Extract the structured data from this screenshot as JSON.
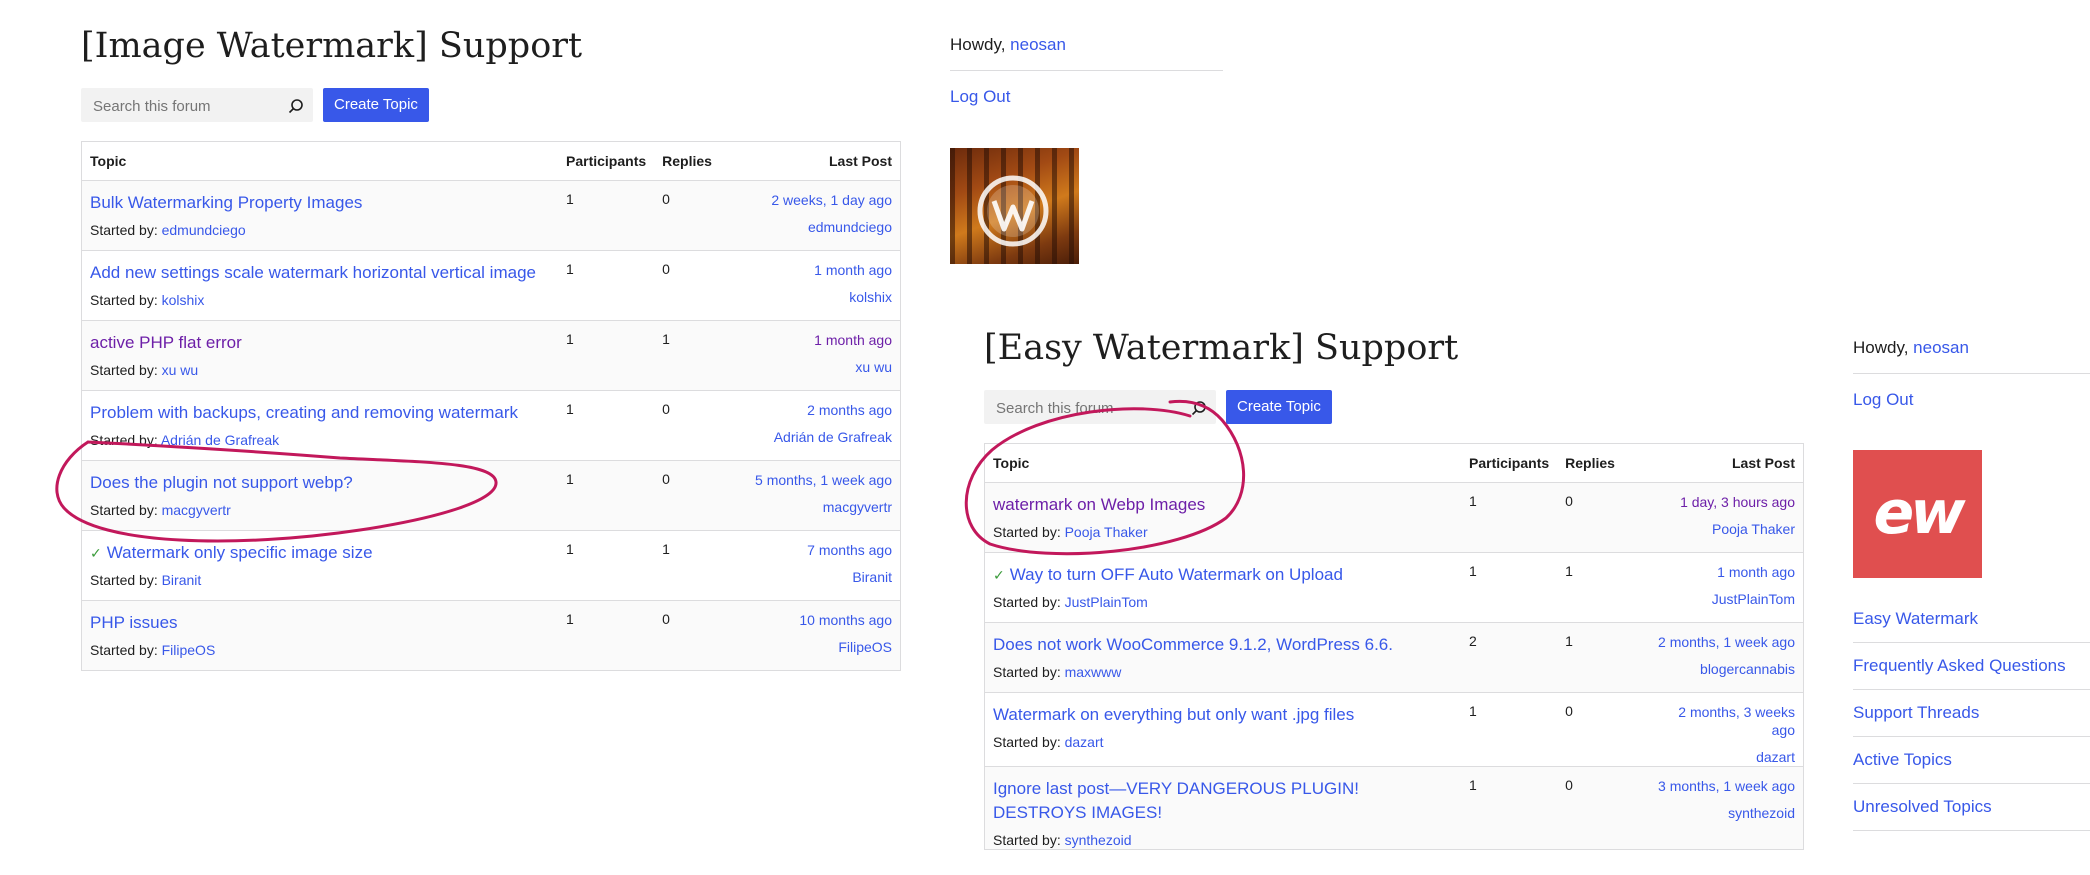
{
  "forum1": {
    "title": "[Image Watermark] Support",
    "search_placeholder": "Search this forum",
    "create_label": "Create Topic",
    "headers": {
      "topic": "Topic",
      "participants": "Participants",
      "replies": "Replies",
      "last_post": "Last Post"
    },
    "started_prefix": "Started by: ",
    "topics": [
      {
        "title": "Bulk Watermarking Property Images",
        "author": "edmundciego",
        "participants": "1",
        "replies": "0",
        "time": "2 weeks, 1 day ago",
        "last_user": "edmundciego",
        "resolved": false,
        "visited": false
      },
      {
        "title": "Add new settings scale watermark horizontal vertical image",
        "author": "kolshix",
        "participants": "1",
        "replies": "0",
        "time": "1 month ago",
        "last_user": "kolshix",
        "resolved": false,
        "visited": false
      },
      {
        "title": "active PHP flat error",
        "author": "xu wu",
        "participants": "1",
        "replies": "1",
        "time": "1 month ago",
        "last_user": "xu wu",
        "resolved": false,
        "visited": true
      },
      {
        "title": "Problem with backups, creating and removing watermark",
        "author": "Adrián de Grafreak",
        "participants": "1",
        "replies": "0",
        "time": "2 months ago",
        "last_user": "Adrián de Grafreak",
        "resolved": false,
        "visited": false
      },
      {
        "title": "Does the plugin not support webp?",
        "author": "macgyvertr",
        "participants": "1",
        "replies": "0",
        "time": "5 months, 1 week ago",
        "last_user": "macgyvertr",
        "resolved": false,
        "visited": false
      },
      {
        "title": "Watermark only specific image size",
        "author": "Biranit",
        "participants": "1",
        "replies": "1",
        "time": "7 months ago",
        "last_user": "Biranit",
        "resolved": true,
        "visited": false
      },
      {
        "title": "PHP issues",
        "author": "FilipeOS",
        "participants": "1",
        "replies": "0",
        "time": "10 months ago",
        "last_user": "FilipeOS",
        "resolved": false,
        "visited": false
      }
    ]
  },
  "sidebar1": {
    "howdy": "Howdy, ",
    "user": "neosan",
    "logout": "Log Out"
  },
  "forum2": {
    "title": "[Easy Watermark] Support",
    "search_placeholder": "Search this forum",
    "create_label": "Create Topic",
    "headers": {
      "topic": "Topic",
      "participants": "Participants",
      "replies": "Replies",
      "last_post": "Last Post"
    },
    "started_prefix": "Started by: ",
    "topics": [
      {
        "title": "watermark on Webp Images",
        "author": "Pooja Thaker",
        "participants": "1",
        "replies": "0",
        "time": "1 day, 3 hours ago",
        "last_user": "Pooja Thaker",
        "resolved": false,
        "visited": true
      },
      {
        "title": "Way to turn OFF Auto Watermark on Upload",
        "author": "JustPlainTom",
        "participants": "1",
        "replies": "1",
        "time": "1 month ago",
        "last_user": "JustPlainTom",
        "resolved": true,
        "visited": false
      },
      {
        "title": "Does not work WooCommerce 9.1.2, WordPress 6.6.",
        "author": "maxwww",
        "participants": "2",
        "replies": "1",
        "time": "2 months, 1 week ago",
        "last_user": "blogercannabis",
        "resolved": false,
        "visited": false
      },
      {
        "title": "Watermark on everything but only want .jpg files",
        "author": "dazart",
        "participants": "1",
        "replies": "0",
        "time": "2 months, 3 weeks ago",
        "last_user": "dazart",
        "resolved": false,
        "visited": false
      },
      {
        "title": "Ignore last post—VERY DANGEROUS PLUGIN! DESTROYS IMAGES!",
        "author": "synthezoid",
        "participants": "1",
        "replies": "0",
        "time": "3 months, 1 week ago",
        "last_user": "synthezoid",
        "resolved": false,
        "visited": false
      }
    ]
  },
  "sidebar2": {
    "howdy": "Howdy, ",
    "user": "neosan",
    "logout": "Log Out",
    "logo_text": "ew",
    "links": [
      "Easy Watermark",
      "Frequently Asked Questions",
      "Support Threads",
      "Active Topics",
      "Unresolved Topics"
    ]
  },
  "colors": {
    "link": "#3858e9",
    "visited": "#6d1fa8",
    "button": "#3858e9",
    "annotation": "#c2185b",
    "resolved_check": "#3a9b3a"
  },
  "icons": {
    "search": "search-icon",
    "check": "check-icon",
    "wp_logo": "wordpress-logo-icon"
  }
}
